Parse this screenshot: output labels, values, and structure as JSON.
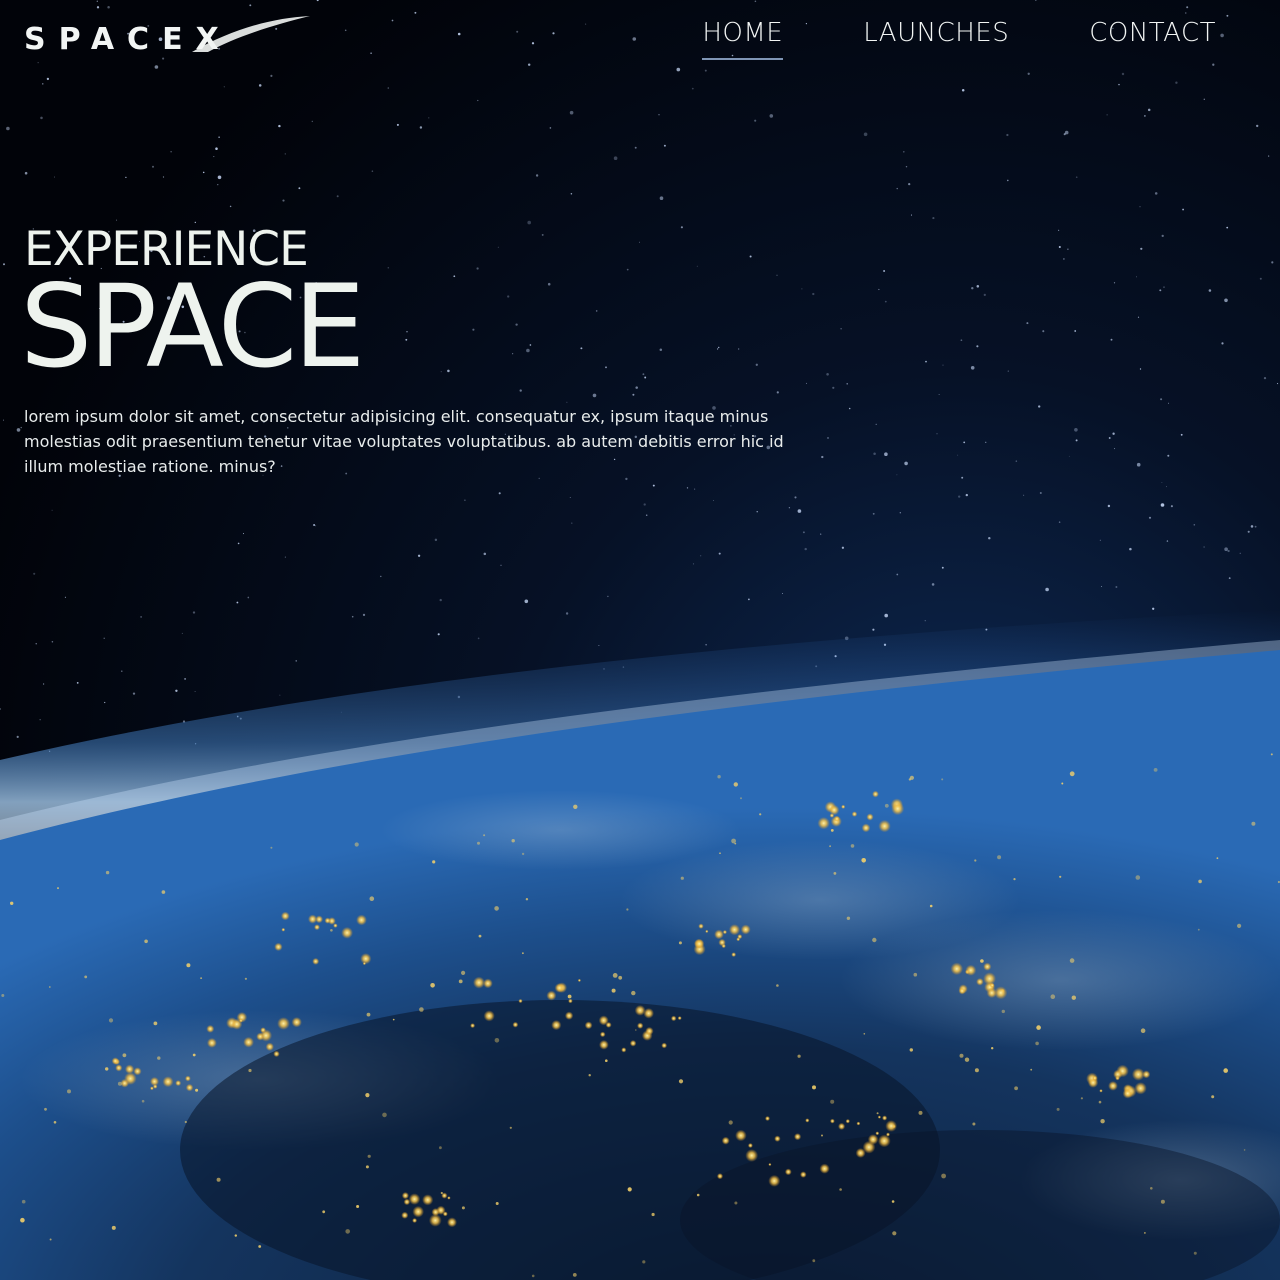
{
  "brand": {
    "logo_text": "SPACEX"
  },
  "nav": {
    "items": [
      {
        "label": "HOME",
        "active": true
      },
      {
        "label": "LAUNCHES",
        "active": false
      },
      {
        "label": "CONTACT",
        "active": false
      }
    ]
  },
  "hero": {
    "kicker": "EXPERIENCE",
    "title": "SPACE",
    "description": "lorem ipsum dolor sit amet, consectetur adipisicing elit. consequatur ex, ipsum itaque minus molestias odit praesentium tenetur vitae voluptates voluptatibus. ab autem debitis error hic id illum molestiae ratione. minus?"
  },
  "colors": {
    "text": "#eef3ee",
    "nav_underline": "#7f95b5",
    "space": "#02050c",
    "atmosphere": "#4a8fd8",
    "city_lights": "#f2c14a"
  }
}
